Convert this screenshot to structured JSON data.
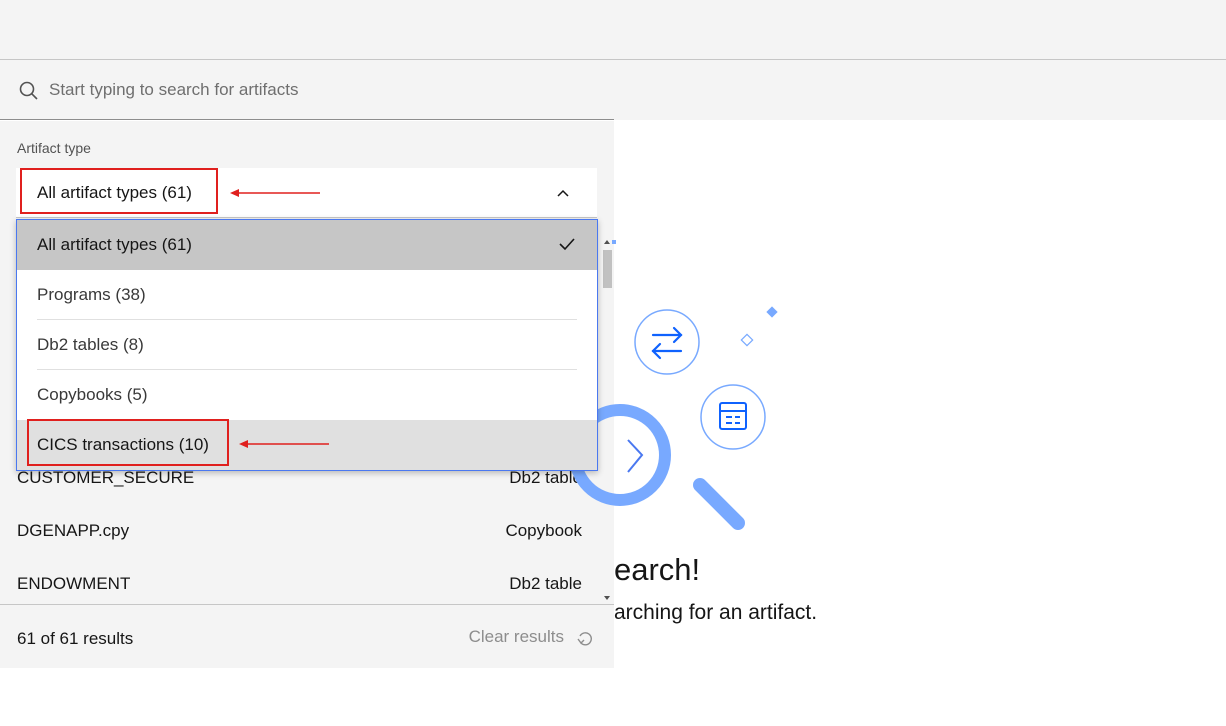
{
  "search": {
    "placeholder": "Start typing to search for artifacts",
    "value": ""
  },
  "filter": {
    "label": "Artifact type",
    "selected": "All artifact types (61)",
    "options": [
      {
        "label": "All artifact types (61)",
        "selected": true
      },
      {
        "label": "Programs (38)",
        "selected": false
      },
      {
        "label": "Db2 tables (8)",
        "selected": false
      },
      {
        "label": "Copybooks (5)",
        "selected": false
      },
      {
        "label": "CICS transactions (10)",
        "selected": false,
        "hovered": true
      }
    ]
  },
  "results": [
    {
      "name": "CUSTOMER_SECURE",
      "type": "Db2 table"
    },
    {
      "name": "DGENAPP.cpy",
      "type": "Copybook"
    },
    {
      "name": "ENDOWMENT",
      "type": "Db2 table"
    }
  ],
  "footer": {
    "count": "61 of 61 results",
    "clear": "Clear results"
  },
  "empty_state": {
    "title": "earch!",
    "subtitle": "arching for an artifact."
  },
  "colors": {
    "panel_bg": "#f4f4f4",
    "menu_border": "#4a78f0",
    "selected_bg": "#c6c6c6",
    "hover_bg": "#e0e0e0",
    "annotation": "#e0201e",
    "illustration_blue": "#78a9ff",
    "icon_blue": "#0f62fe"
  },
  "icons": {
    "search": "search-icon",
    "chevron": "chevron-up-icon",
    "check": "check-icon",
    "reset": "reset-icon",
    "transfer": "arrows-transfer-icon",
    "table": "table-icon"
  }
}
